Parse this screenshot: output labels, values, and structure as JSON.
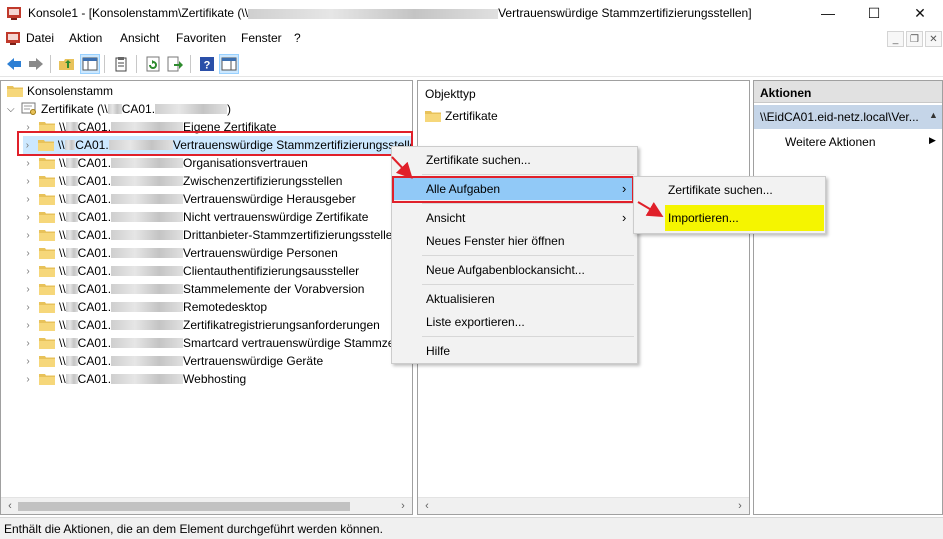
{
  "window": {
    "title_prefix": "Konsole1 - [Konsolenstamm\\Zertifikate (\\\\",
    "title_suffix": "Vertrauenswürdige Stammzertifizierungsstellen]",
    "minimize": "—",
    "maximize": "☐",
    "close": "✕"
  },
  "menu": {
    "items": [
      "Datei",
      "Aktion",
      "Ansicht",
      "Favoriten",
      "Fenster",
      "?"
    ],
    "mdi_minimize": "_",
    "mdi_restore": "❐",
    "mdi_close": "✕"
  },
  "tree": {
    "root": "Konsolenstamm",
    "certs_prefix": "Zertifikate (\\\\",
    "certs_mid": "CA01.",
    "certs_suffix": ")",
    "node_prefix": "\\\\",
    "node_mid": "CA01.",
    "children": [
      "Eigene Zertifikate",
      "Vertrauenswürdige Stammzertifizierungsstellen",
      "Organisationsvertrauen",
      "Zwischenzertifizierungsstellen",
      "Vertrauenswürdige Herausgeber",
      "Nicht vertrauenswürdige Zertifikate",
      "Drittanbieter-Stammzertifizierungsstellen",
      "Vertrauenswürdige Personen",
      "Clientauthentifizierungsaussteller",
      "Stammelemente der Vorabversion",
      "Remotedesktop",
      "Zertifikatregistrierungsanforderungen",
      "Smartcard vertrauenswürdige Stammzertifizierungsstellen",
      "Vertrauenswürdige Geräte",
      "Webhosting"
    ]
  },
  "middle": {
    "header": "Objekttyp",
    "item": "Zertifikate"
  },
  "context_menu": {
    "items": {
      "find": "Zertifikate suchen...",
      "all_tasks": "Alle Aufgaben",
      "view": "Ansicht",
      "new_window": "Neues Fenster hier öffnen",
      "new_taskpad": "Neue Aufgabenblockansicht...",
      "refresh": "Aktualisieren",
      "export": "Liste exportieren...",
      "help": "Hilfe"
    },
    "arrow": "›"
  },
  "submenu": {
    "find": "Zertifikate suchen...",
    "import": "Importieren..."
  },
  "actions": {
    "header": "Aktionen",
    "selected": "\\\\EidCA01.eid-netz.local\\Ver...",
    "more": "Weitere Aktionen",
    "more_arrow": "▶",
    "collapse_arrow": "▲"
  },
  "status": "Enthält die Aktionen, die an dem Element durchgeführt werden können.",
  "colors": {
    "highlight": "#cce8ff",
    "menu_highlight": "#91c9f7",
    "annotation_red": "#e0202a",
    "import_highlight": "#f5f500",
    "actions_header": "#e1e1e1",
    "actions_selected": "#c5d5e8"
  }
}
